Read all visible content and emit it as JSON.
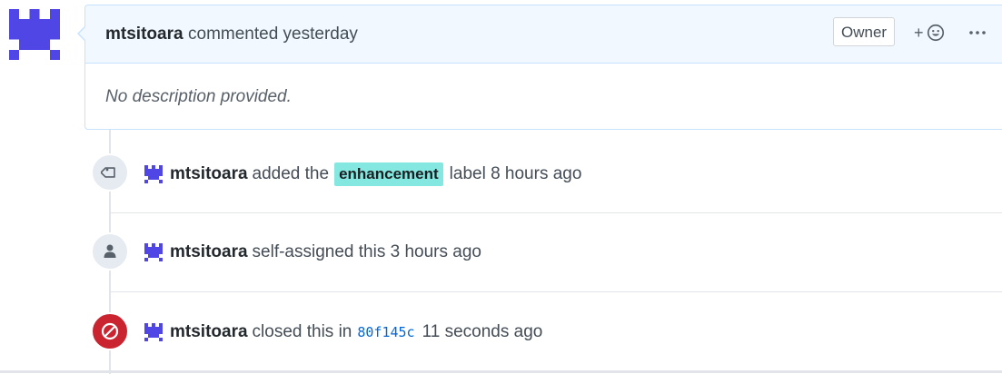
{
  "comment": {
    "author": "mtsitoara",
    "action": "commented yesterday",
    "author_role_badge": "Owner",
    "reaction_plus": "+",
    "body": "No description provided."
  },
  "icons": {
    "avatar": "identicon-avatar",
    "reaction": "smiley-icon",
    "more": "kebab-horizontal-icon",
    "label_event": "tag-icon",
    "assign_event": "person-icon",
    "closed_event": "circle-slash-icon"
  },
  "events": [
    {
      "actor": "mtsitoara",
      "prefix": "added the",
      "label": "enhancement",
      "suffix": "label 8 hours ago"
    },
    {
      "actor": "mtsitoara",
      "text": "self-assigned this 3 hours ago"
    },
    {
      "actor": "mtsitoara",
      "prefix": "closed this in",
      "commit": "80f145c",
      "suffix": "11 seconds ago"
    }
  ],
  "colors": {
    "avatar": "#4f46e5",
    "label_bg": "#84e7e0",
    "closed_badge": "#cb2431",
    "commit_link": "#0366d6",
    "header_bg": "#f1f8ff",
    "header_border": "#c8e1ff"
  }
}
